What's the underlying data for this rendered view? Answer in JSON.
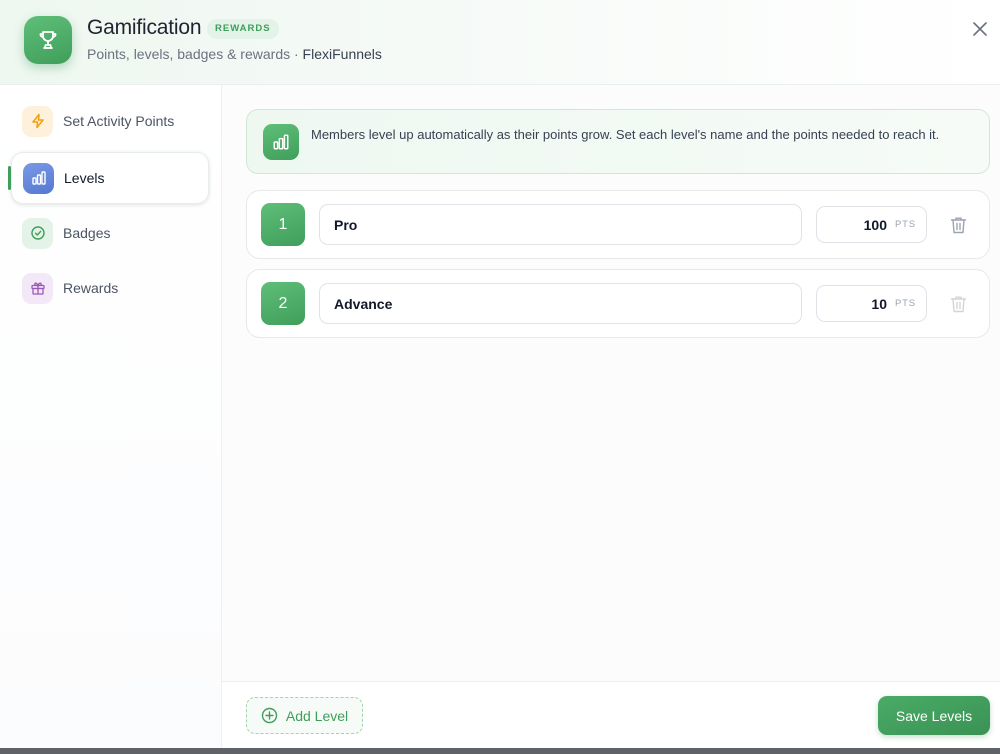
{
  "header": {
    "title": "Gamification",
    "badge": "REWARDS",
    "subtitle": "Points, levels, badges & rewards · ",
    "brand": "FlexiFunnels"
  },
  "sidebar": {
    "items": [
      {
        "label": "Set Activity Points",
        "icon": "lightning-icon",
        "color": "#f59e0b"
      },
      {
        "label": "Levels",
        "icon": "bar-chart-icon",
        "color": "#5b7fd6",
        "active": true
      },
      {
        "label": "Badges",
        "icon": "check-circle-icon",
        "color": "#3f9e5b"
      },
      {
        "label": "Rewards",
        "icon": "gift-icon",
        "color": "#9b59b6"
      }
    ]
  },
  "main": {
    "info_text": "Members level up automatically as their points grow. Set each level's name and the points needed to reach it.",
    "levels": [
      {
        "number": "1",
        "name": "Pro",
        "points": "100",
        "unit": "PTS"
      },
      {
        "number": "2",
        "name": "Advance",
        "points": "10",
        "unit": "PTS"
      }
    ]
  },
  "footer": {
    "add_label": "Add Level",
    "save_label": "Save Levels"
  },
  "colors": {
    "accent": "#3f9e5b",
    "accent_light": "#e3f3e7"
  }
}
